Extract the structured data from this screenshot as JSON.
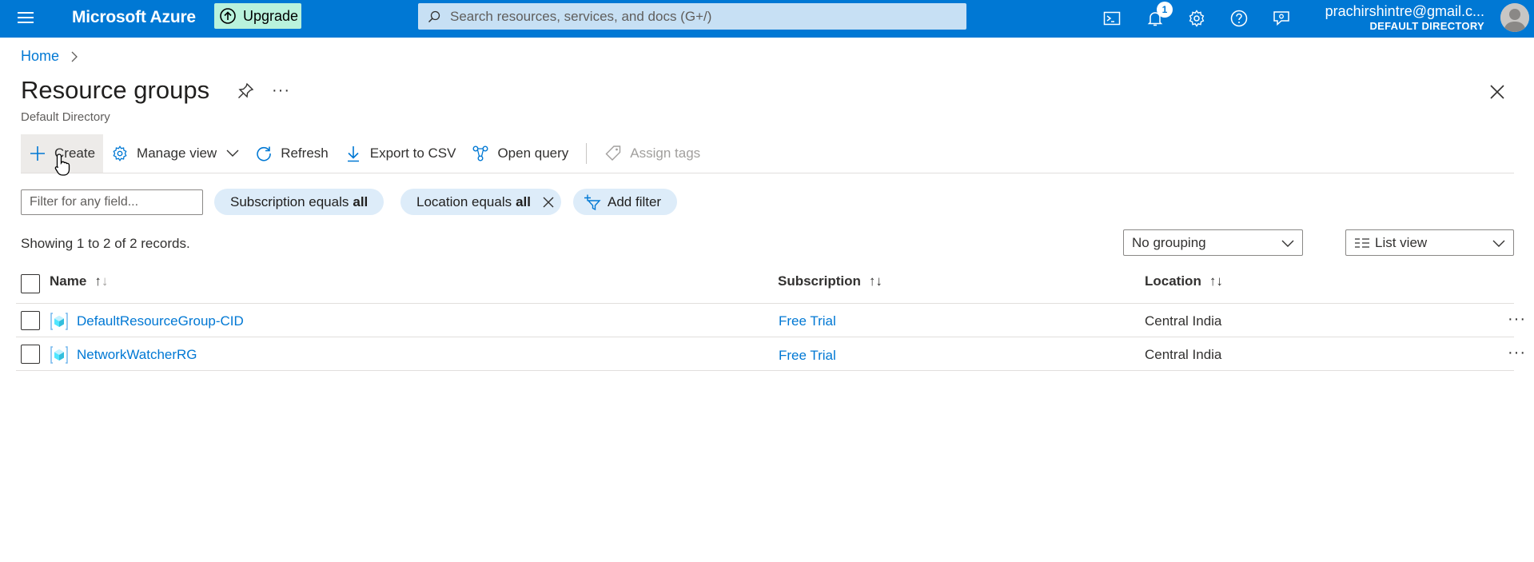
{
  "topbar": {
    "brand": "Microsoft Azure",
    "upgrade_label": "Upgrade",
    "search_placeholder": "Search resources, services, and docs (G+/)",
    "notification_count": "1",
    "account_email": "prachirshintre@gmail.c...",
    "account_directory": "DEFAULT DIRECTORY",
    "icons": [
      "menu-icon",
      "upgrade-arrow-icon",
      "search-icon",
      "cloud-shell-icon",
      "bell-icon",
      "gear-icon",
      "help-icon",
      "feedback-icon",
      "avatar-icon"
    ]
  },
  "breadcrumb": {
    "home": "Home"
  },
  "page": {
    "title": "Resource groups",
    "subtitle": "Default Directory",
    "more": "···"
  },
  "toolbar": {
    "create": "Create",
    "manage_view": "Manage view",
    "refresh": "Refresh",
    "export_csv": "Export to CSV",
    "open_query": "Open query",
    "assign_tags": "Assign tags"
  },
  "filters": {
    "placeholder": "Filter for any field...",
    "subscription_prefix": "Subscription equals",
    "subscription_value": "all",
    "location_prefix": "Location equals",
    "location_value": "all",
    "add_filter": "Add filter"
  },
  "records_text": "Showing 1 to 2 of 2 records.",
  "grouping": {
    "selected": "No grouping"
  },
  "view": {
    "selected": "List view"
  },
  "table": {
    "headers": {
      "name": "Name",
      "subscription": "Subscription",
      "location": "Location"
    },
    "rows": [
      {
        "name": "DefaultResourceGroup-CID",
        "subscription": "Free Trial",
        "location": "Central India",
        "more": "···"
      },
      {
        "name": "NetworkWatcherRG",
        "subscription": "Free Trial",
        "location": "Central India",
        "more": "···"
      }
    ]
  },
  "colors": {
    "accent": "#0078d4",
    "pill": "#ddecf9",
    "upgrade": "#b9f2dc"
  }
}
